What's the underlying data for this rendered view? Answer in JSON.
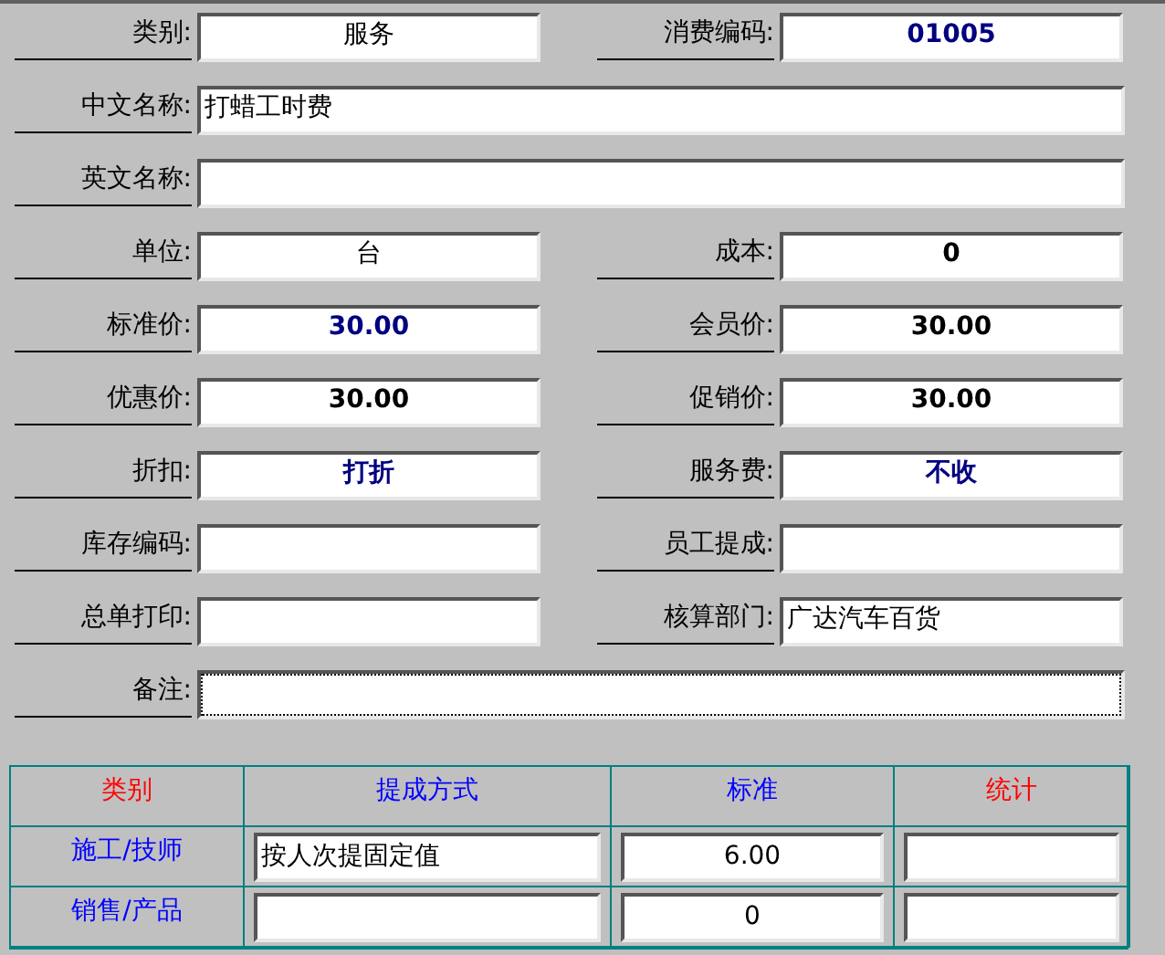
{
  "form_rows": [
    {
      "fields": [
        {
          "label": "类别:",
          "value": "服务",
          "kind": "centered",
          "wide": false
        },
        {
          "label": "消费编码:",
          "value": "01005",
          "kind": "emphasis",
          "wide": false
        }
      ]
    },
    {
      "fields": [
        {
          "label": "中文名称:",
          "value": "打蜡工时费",
          "kind": "text",
          "wide": true
        }
      ]
    },
    {
      "fields": [
        {
          "label": "英文名称:",
          "kind": "text",
          "wide": true
        }
      ]
    },
    {
      "fields": [
        {
          "label": "单位:",
          "value": "台",
          "kind": "centered",
          "wide": false
        },
        {
          "label": "成本:",
          "value": "0",
          "kind": "number",
          "wide": false
        }
      ]
    },
    {
      "fields": [
        {
          "label": "标准价:",
          "value": "30.00",
          "kind": "emphasis",
          "wide": false
        },
        {
          "label": "会员价:",
          "value": "30.00",
          "kind": "number",
          "wide": false
        }
      ]
    },
    {
      "fields": [
        {
          "label": "优惠价:",
          "value": "30.00",
          "kind": "number",
          "wide": false
        },
        {
          "label": "促销价:",
          "value": "30.00",
          "kind": "number",
          "wide": false
        }
      ]
    },
    {
      "fields": [
        {
          "label": "折扣:",
          "value": "打折",
          "kind": "emphasis",
          "wide": false
        },
        {
          "label": "服务费:",
          "value": "不收",
          "kind": "emphasis",
          "wide": false
        }
      ]
    },
    {
      "fields": [
        {
          "label": "库存编码:",
          "kind": "text",
          "wide": false
        },
        {
          "label": "员工提成:",
          "kind": "text",
          "wide": false
        }
      ]
    },
    {
      "fields": [
        {
          "label": "总单打印:",
          "kind": "text",
          "wide": false
        },
        {
          "label": "核算部门:",
          "value": "广达汽车百货",
          "kind": "text",
          "wide": false
        }
      ]
    },
    {
      "fields": [
        {
          "label": "备注:",
          "kind": "text",
          "wide": true,
          "focused": true
        }
      ]
    }
  ],
  "commission_table": {
    "columns": [
      {
        "label": "类别",
        "color": "#ff0000"
      },
      {
        "label": "提成方式",
        "color": "#0000ff"
      },
      {
        "label": "标准",
        "color": "#0000ff"
      },
      {
        "label": "统计",
        "color": "#ff0000"
      }
    ],
    "rows": [
      {
        "category": "施工/技师",
        "method": "按人次提固定值",
        "standard": "6.00"
      },
      {
        "category": "销售/产品",
        "standard": "0"
      }
    ]
  }
}
